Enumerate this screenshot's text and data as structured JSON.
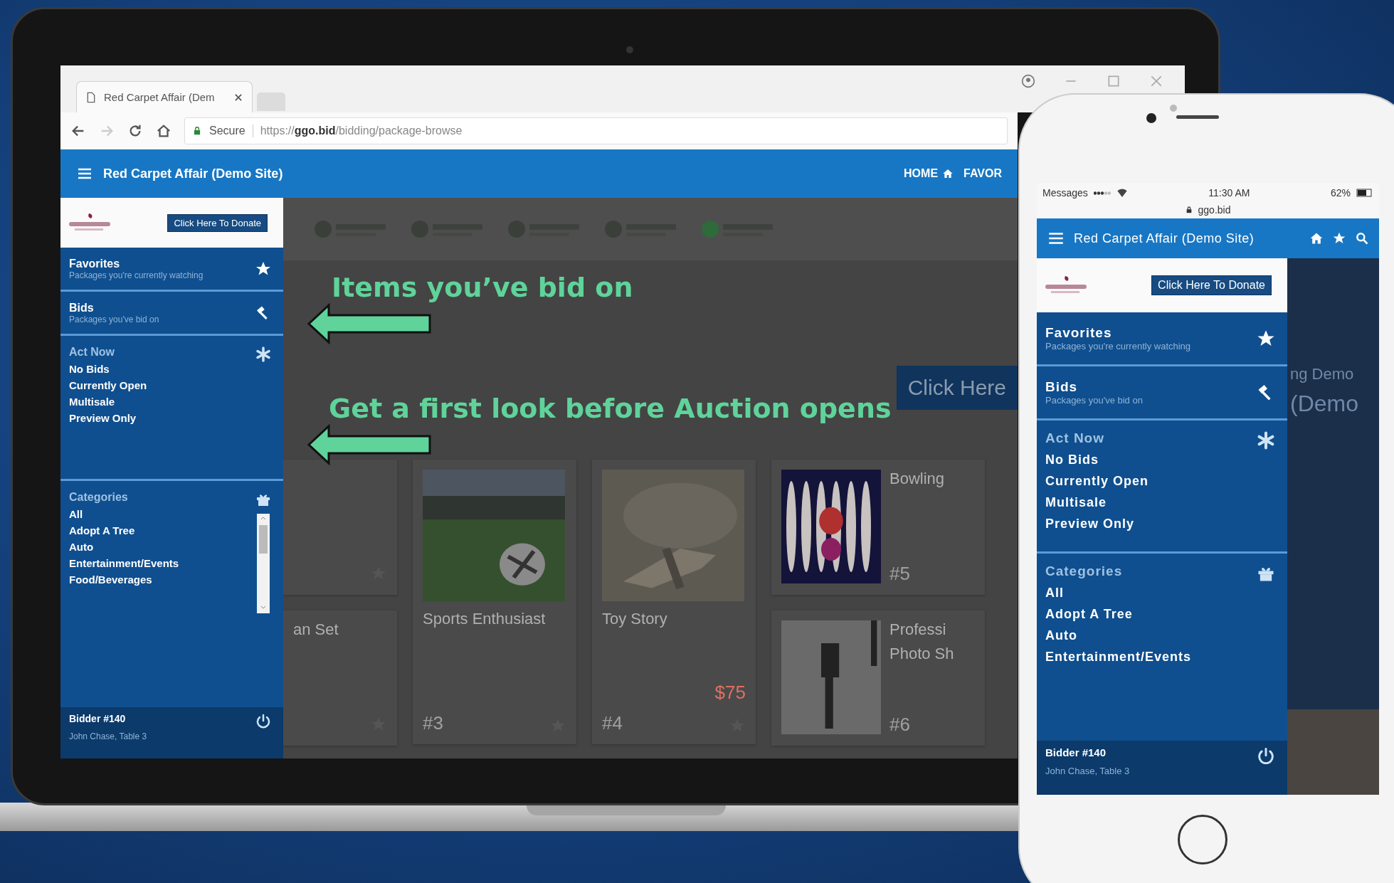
{
  "laptop": {
    "browser": {
      "tab_title": "Red Carpet Affair (Dem",
      "secure_label": "Secure",
      "url": "https://**ggo.bid**/bidding/package-browse"
    },
    "header": {
      "title": "Red Carpet Affair (Demo Site)",
      "nav": [
        {
          "label": "HOME"
        },
        {
          "label": "FAVOR"
        }
      ]
    },
    "sidebar": {
      "donate_button": "Click Here To Donate",
      "favorites": {
        "title": "Favorites",
        "subtitle": "Packages you're currently watching"
      },
      "bids": {
        "title": "Bids",
        "subtitle": "Packages you've bid on"
      },
      "act_now": {
        "title": "Act Now",
        "items": [
          "No Bids",
          "Currently Open",
          "Multisale",
          "Preview Only"
        ]
      },
      "categories": {
        "title": "Categories",
        "items": [
          "All",
          "Adopt A Tree",
          "Auto",
          "Entertainment/Events",
          "Food/Beverages"
        ]
      },
      "footer": {
        "bidder": "Bidder #140",
        "name": "John Chase, Table 3"
      }
    },
    "content": {
      "button": "Click Here",
      "columns": [
        [
          {
            "kind": "short"
          },
          {
            "kind": "short",
            "lines": [
              "an Set"
            ]
          }
        ],
        [
          {
            "kind": "tall",
            "lines": [
              "Sports Enthusiast"
            ],
            "number": "#3"
          }
        ],
        [
          {
            "kind": "tall",
            "lines": [
              "Toy Story"
            ],
            "price": "$75",
            "number": "#4"
          }
        ],
        [
          {
            "kind": "wide",
            "lines": [
              "Bowling"
            ],
            "number": "#5"
          },
          {
            "kind": "wide",
            "lines": [
              "Professi",
              "Photo Sh"
            ],
            "number": "#6"
          }
        ]
      ]
    }
  },
  "annotations": [
    {
      "text": "Items you’ve bid on"
    },
    {
      "text": "Get a first look before Auction opens"
    }
  ],
  "phone": {
    "status": {
      "app": "Messages",
      "time": "11:30 AM",
      "battery": "62%",
      "address": "ggo.bid"
    },
    "header": {
      "title": "Red Carpet Affair (Demo Site)"
    },
    "sidebar": {
      "donate_button": "Click Here To Donate",
      "favorites": {
        "title": "Favorites",
        "subtitle": "Packages you're currently watching"
      },
      "bids": {
        "title": "Bids",
        "subtitle": "Packages you've bid on"
      },
      "act_now": {
        "title": "Act Now",
        "items": [
          "No Bids",
          "Currently Open",
          "Multisale",
          "Preview Only"
        ]
      },
      "categories": {
        "title": "Categories",
        "items": [
          "All",
          "Adopt A Tree",
          "Auto",
          "Entertainment/Events"
        ]
      },
      "footer": {
        "bidder": "Bidder #140",
        "name": "John Chase, Table 3"
      }
    },
    "background_texts": [
      "ng Demo",
      "(Demo"
    ]
  }
}
